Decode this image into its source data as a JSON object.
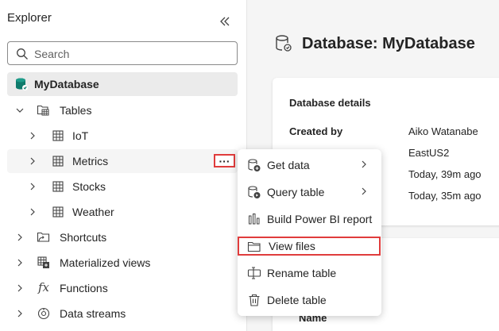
{
  "explorer": {
    "title": "Explorer",
    "search_placeholder": "Search"
  },
  "tree": {
    "database": "MyDatabase",
    "tables_label": "Tables",
    "tables": [
      "IoT",
      "Metrics",
      "Stocks",
      "Weather"
    ],
    "shortcuts": "Shortcuts",
    "materialized_views": "Materialized views",
    "functions": "Functions",
    "data_streams": "Data streams"
  },
  "main": {
    "title": "Database: MyDatabase",
    "details_title": "Database details",
    "created_by_label": "Created by",
    "created_by_value": "Aiko Watanabe",
    "region_value": "EastUS2",
    "created_on_value": "Today, 39m ago",
    "last_ingestion_value": "Today, 35m ago",
    "second_card_label": "Name"
  },
  "context_menu": {
    "items": [
      "Get data",
      "Query table",
      "Build Power BI report",
      "View files",
      "Rename table",
      "Delete table"
    ]
  },
  "colors": {
    "highlight_border": "#e03c3c",
    "selected_row": "#ebebeb",
    "db_icon": "#0f7b6c"
  }
}
